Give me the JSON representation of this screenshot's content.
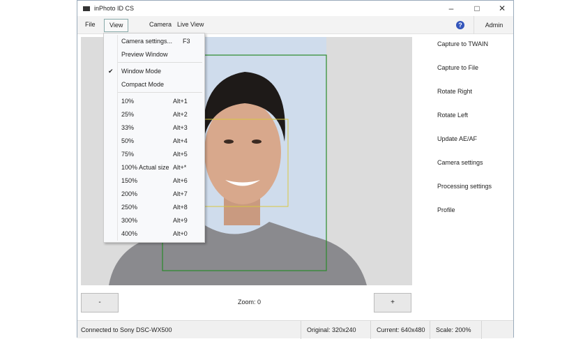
{
  "app": {
    "title": "inPhoto ID CS"
  },
  "menu": {
    "file": "File",
    "view": "View",
    "camera": "Camera",
    "live_view": "Live View",
    "help": "?",
    "admin": "Admin"
  },
  "view_menu": {
    "top": [
      {
        "label": "Camera settings...",
        "shortcut": "F3"
      },
      {
        "label": "Preview Window",
        "shortcut": ""
      }
    ],
    "modes": [
      {
        "label": "Window Mode",
        "checked": true
      },
      {
        "label": "Compact Mode",
        "checked": false
      }
    ],
    "zoom": [
      {
        "label": "10%",
        "shortcut": "Alt+1"
      },
      {
        "label": "25%",
        "shortcut": "Alt+2"
      },
      {
        "label": "33%",
        "shortcut": "Alt+3"
      },
      {
        "label": "50%",
        "shortcut": "Alt+4"
      },
      {
        "label": "75%",
        "shortcut": "Alt+5"
      },
      {
        "label": "100% Actual size",
        "shortcut": "Alt+*"
      },
      {
        "label": "150%",
        "shortcut": "Alt+6"
      },
      {
        "label": "200%",
        "shortcut": "Alt+7"
      },
      {
        "label": "250%",
        "shortcut": "Alt+8"
      },
      {
        "label": "300%",
        "shortcut": "Alt+9"
      },
      {
        "label": "400%",
        "shortcut": "Alt+0"
      }
    ],
    "check_mark": "✔"
  },
  "side": [
    "Capture to TWAIN",
    "Capture to File",
    "Rotate Right",
    "Rotate Left",
    "Update AE/AF",
    "Camera settings",
    "Processing settings",
    "Profile"
  ],
  "zoom": {
    "minus": "-",
    "plus": "+",
    "label": "Zoom: 0"
  },
  "status": {
    "connection": "Connected to Sony DSC-WX500",
    "original": "Original: 320x240",
    "current": "Current: 640x480",
    "scale": "Scale: 200%"
  }
}
